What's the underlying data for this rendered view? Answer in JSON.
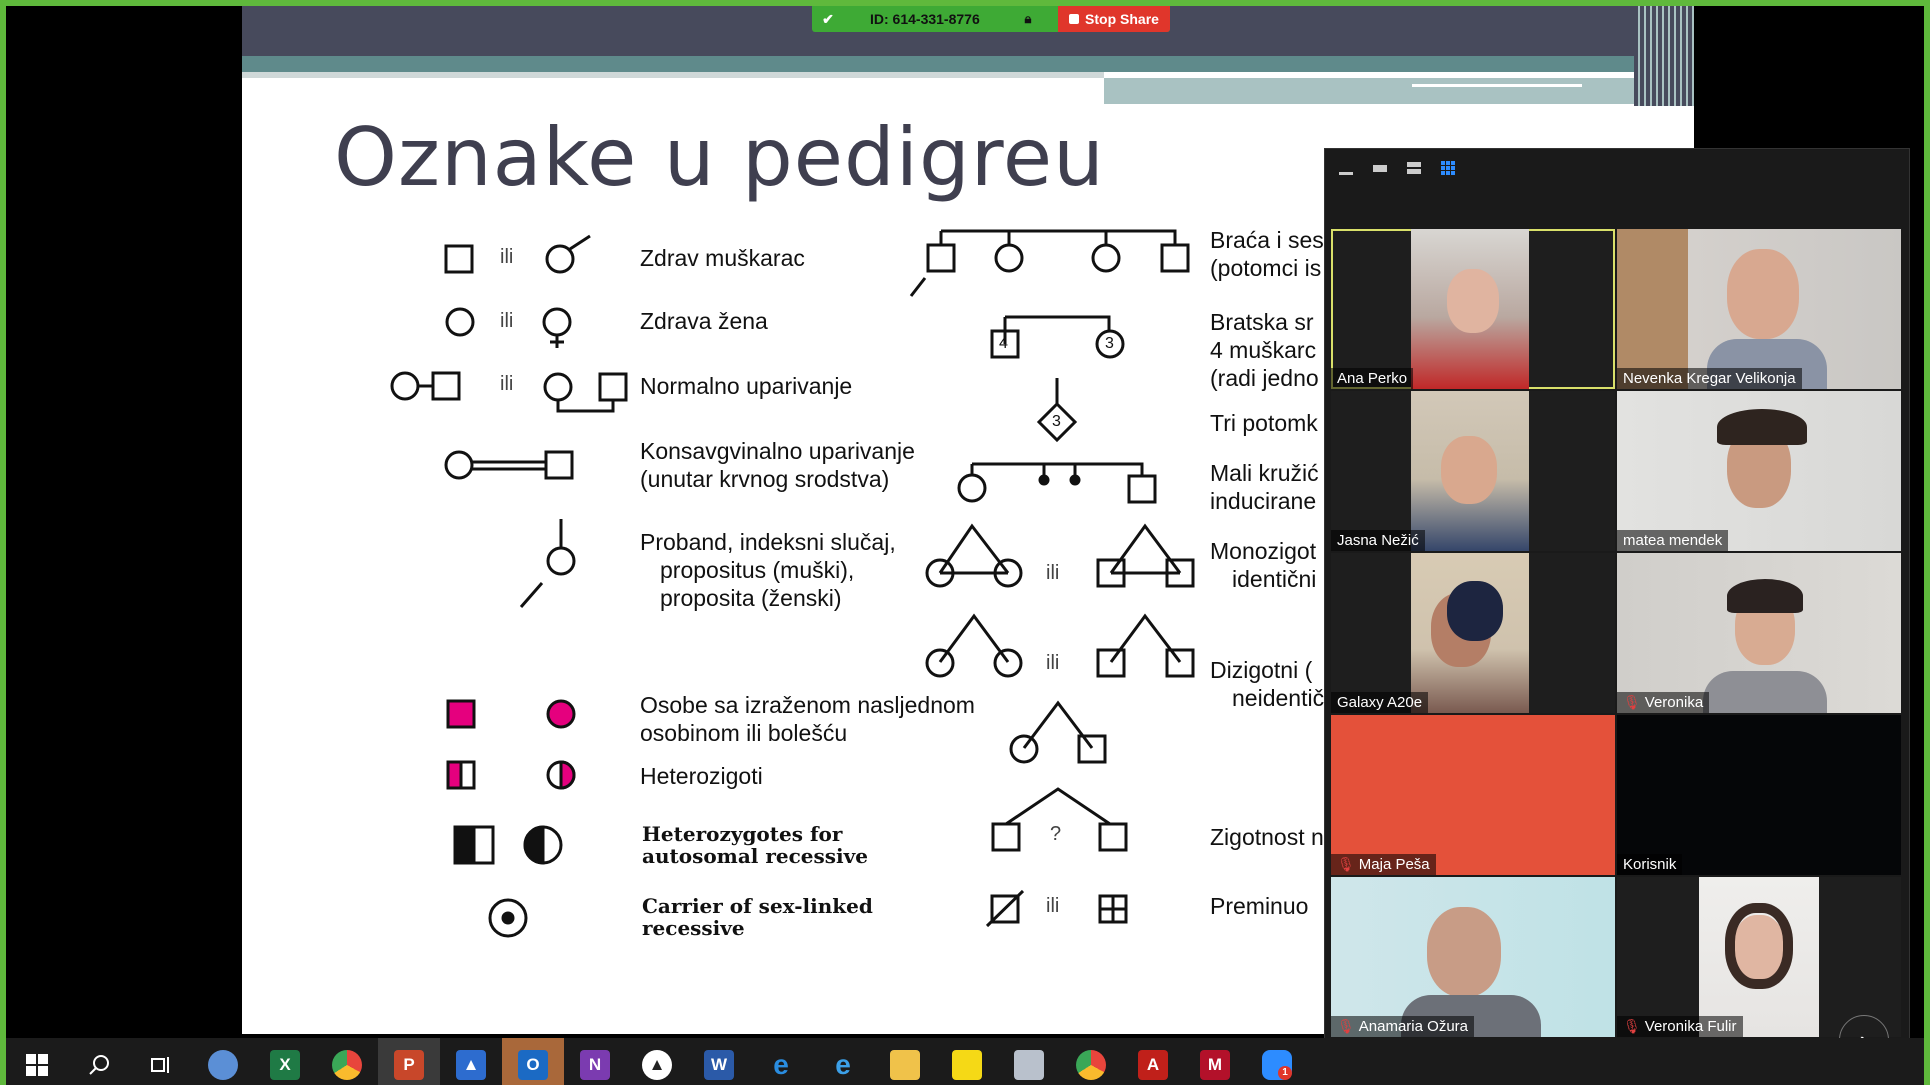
{
  "meeting": {
    "id_label": "ID: 614-331-8776",
    "stop_share": "Stop Share"
  },
  "slide": {
    "title": "Oznake u pedigreu",
    "left": {
      "ili1": "ili",
      "ili2": "ili",
      "ili3": "ili",
      "healthy_male": "Zdrav muškarac",
      "healthy_female": "Zdrava žena",
      "normal_mating": "Normalno uparivanje",
      "consang1": "Konsavgvinalno uparivanje",
      "consang2": "(unutar krvnog srodstva)",
      "proband1": "Proband, indeksni slučaj,",
      "proband2": "propositus (muški),",
      "proband3": "proposita (ženski)",
      "affected1": "Osobe sa izraženom nasljednom",
      "affected2": "osobinom ili bolešću",
      "hetero": "Heterozigoti",
      "ar1": "Heterozygotes for",
      "ar2": "autosomal recessive",
      "xl1": "Carrier of sex-linked",
      "xl2": "recessive"
    },
    "middle": {
      "num4": "4",
      "num3a": "3",
      "num3b": "3",
      "ili_mono": "ili",
      "ili_di": "ili",
      "ili_dead": "ili",
      "question": "?"
    },
    "right": {
      "sibs1": "Braća i ses",
      "sibs2": "(potomci is",
      "bratska1": "Bratska sr",
      "bratska2": "4 muškarc",
      "bratska3": "(radi jedno",
      "tri": "Tri potomk",
      "mali1": "Mali kružić",
      "mali2": "inducirane",
      "mono1": "Monozigot",
      "mono2": "identični",
      "di1": "Dizigotni (",
      "di2": "neidentič",
      "zig": "Zigotnost n",
      "prem": "Preminuo"
    }
  },
  "zoom_panel": {
    "participants": [
      {
        "name": "Ana Perko",
        "muted": false
      },
      {
        "name": "Nevenka Kregar Velikonja",
        "muted": false
      },
      {
        "name": "Jasna Nežić",
        "muted": false
      },
      {
        "name": "matea mendek",
        "muted": false
      },
      {
        "name": "Galaxy A20e",
        "muted": false
      },
      {
        "name": "Veronika",
        "muted": true
      },
      {
        "name": "Maja Peša",
        "muted": true
      },
      {
        "name": "Korisnik",
        "muted": false
      },
      {
        "name": "Anamaria Ožura",
        "muted": true
      },
      {
        "name": "Veronika Fulir",
        "muted": true
      }
    ]
  },
  "taskbar": {
    "icons": [
      "windows-start-icon",
      "search-icon",
      "task-view-icon",
      "ie-old-icon",
      "excel-icon",
      "chrome-icon",
      "powerpoint-icon",
      "teacher-tool-icon",
      "outlook-icon",
      "onenote-icon",
      "photos-icon",
      "word-icon",
      "edge-icon",
      "internet-explorer-icon",
      "file-explorer-icon",
      "sticky-notes-icon",
      "scanner-icon",
      "chrome-user-icon",
      "acrobat-icon",
      "mendeley-icon",
      "zoom-icon"
    ],
    "labels": {
      "excel": "X",
      "ppt": "P",
      "outlook": "O",
      "onenote": "N",
      "word": "W",
      "edge": "e",
      "ie": "e",
      "acrobat": "A",
      "mendeley": "M",
      "zoom_badge": "1"
    }
  }
}
